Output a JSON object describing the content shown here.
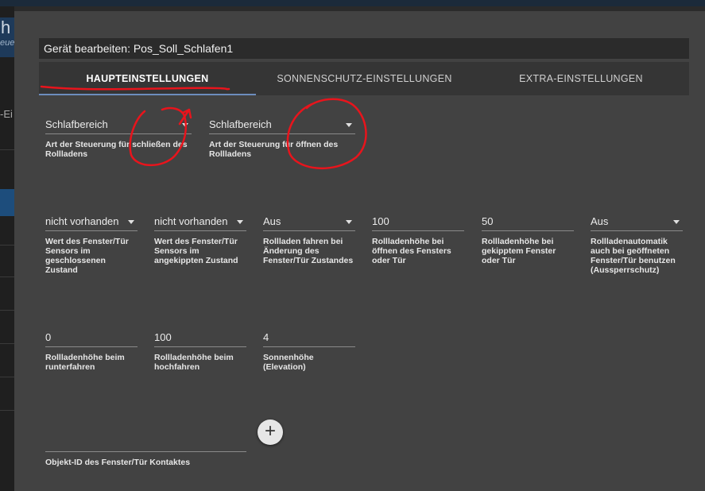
{
  "background": {
    "header_letter": "h",
    "subtitle_fragment": "euer",
    "side_fragment": "-Ei"
  },
  "dialog": {
    "title": "Gerät bearbeiten: Pos_Soll_Schlafen1",
    "tabs": [
      {
        "label": "HAUPTEINSTELLUNGEN",
        "active": true
      },
      {
        "label": "SONNENSCHUTZ-EINSTELLUNGEN",
        "active": false
      },
      {
        "label": "EXTRA-EINSTELLUNGEN",
        "active": false
      }
    ],
    "fields": {
      "close_mode": {
        "value": "Schlafbereich",
        "label": "Art der Steuerung für schließen des Rollladens"
      },
      "open_mode": {
        "value": "Schlafbereich",
        "label": "Art der Steuerung für öffnen des Rollladens"
      },
      "sensor_closed": {
        "value": "nicht vorhanden",
        "label": "Wert des Fenster/Tür Sensors im geschlossenen Zustand"
      },
      "sensor_tilted": {
        "value": "nicht vorhanden",
        "label": "Wert des Fenster/Tür Sensors im angekippten Zustand"
      },
      "move_on_change": {
        "value": "Aus",
        "label": "Rollladen fahren bei Änderung des Fenster/Tür Zustandes"
      },
      "height_open": {
        "value": "100",
        "label": "Rollladenhöhe bei öffnen des Fensters oder Tür"
      },
      "height_tilted": {
        "value": "50",
        "label": "Rollladenhöhe bei gekipptem Fenster oder Tür"
      },
      "lockout": {
        "value": "Aus",
        "label": "Rollladenautomatik auch bei geöffneten Fenster/Tür benutzen (Aussperrschutz)"
      },
      "height_down": {
        "value": "0",
        "label": "Rollladenhöhe beim runterfahren"
      },
      "height_up": {
        "value": "100",
        "label": "Rollladenhöhe beim hochfahren"
      },
      "elevation": {
        "value": "4",
        "label": "Sonnenhöhe (Elevation)"
      },
      "contact_object": {
        "value": "",
        "label": "Objekt-ID des Fenster/Tür Kontaktes"
      }
    },
    "add_button": "+"
  },
  "annotation_color": "#e8141c"
}
